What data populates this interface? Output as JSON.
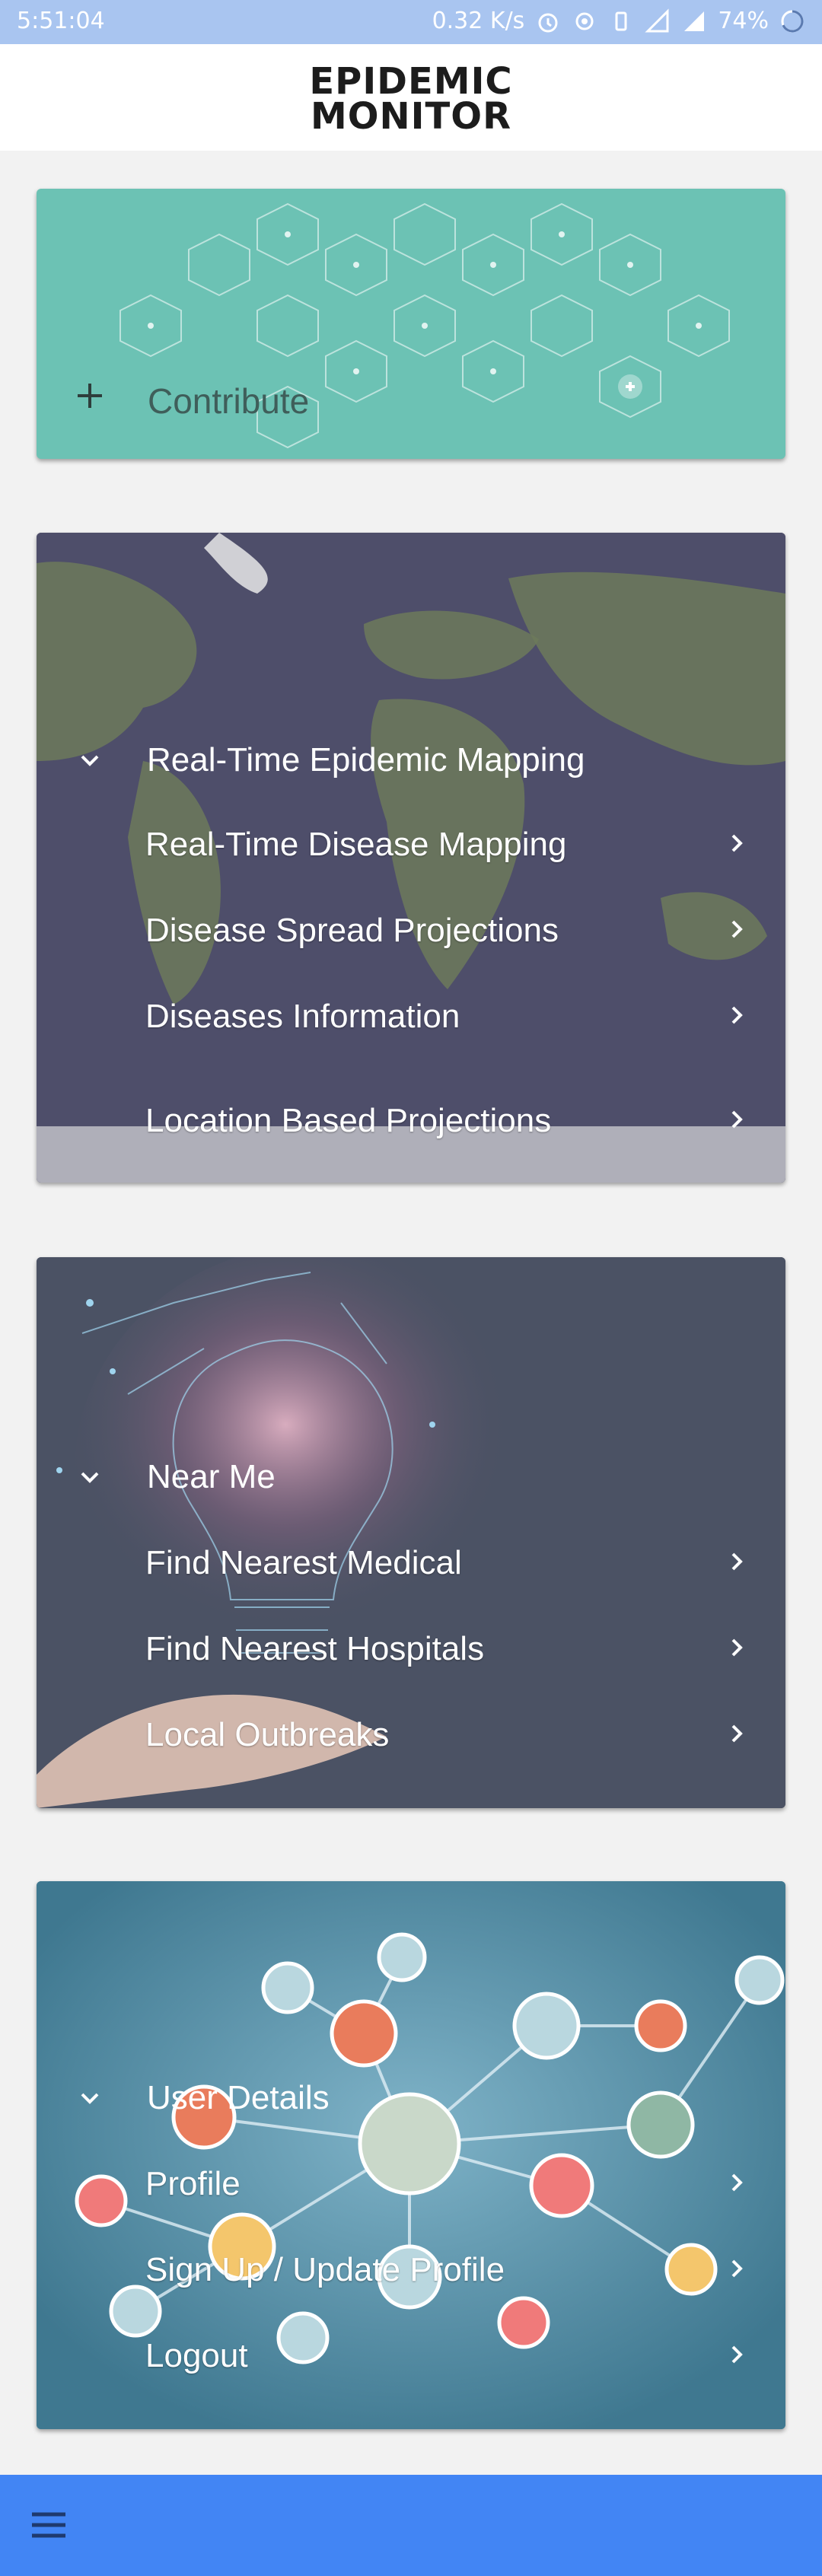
{
  "status_bar": {
    "time": "5:51:04",
    "network_speed": "0.32 K/s",
    "battery": "74%"
  },
  "app": {
    "logo_line1": "EPIDEMIC",
    "logo_line2": "MONITOR"
  },
  "contribute": {
    "label": "Contribute",
    "icon": "plus-icon"
  },
  "sections": [
    {
      "title": "Real-Time Epidemic Mapping",
      "expanded": true,
      "background": "world-map",
      "items": [
        {
          "label": "Real-Time Disease Mapping"
        },
        {
          "label": "Disease Spread Projections"
        },
        {
          "label": "Diseases Information"
        },
        {
          "label": "Location Based Projections"
        }
      ]
    },
    {
      "title": "Near Me",
      "expanded": true,
      "background": "lightbulb-in-hand",
      "items": [
        {
          "label": "Find Nearest Medical"
        },
        {
          "label": "Find Nearest Hospitals"
        },
        {
          "label": "Local Outbreaks"
        }
      ]
    },
    {
      "title": "User Details",
      "expanded": true,
      "background": "people-network",
      "items": [
        {
          "label": "Profile"
        },
        {
          "label": "Sign Up / Update Profile"
        },
        {
          "label": "Logout"
        }
      ]
    }
  ],
  "bottom_bar": {
    "menu_icon": "hamburger-menu-icon"
  },
  "colors": {
    "status_bar": "#a9c5f0",
    "contribute_card": "#6cc2b4",
    "bottom_bar": "#4285f4",
    "text_light": "#ffffff"
  }
}
